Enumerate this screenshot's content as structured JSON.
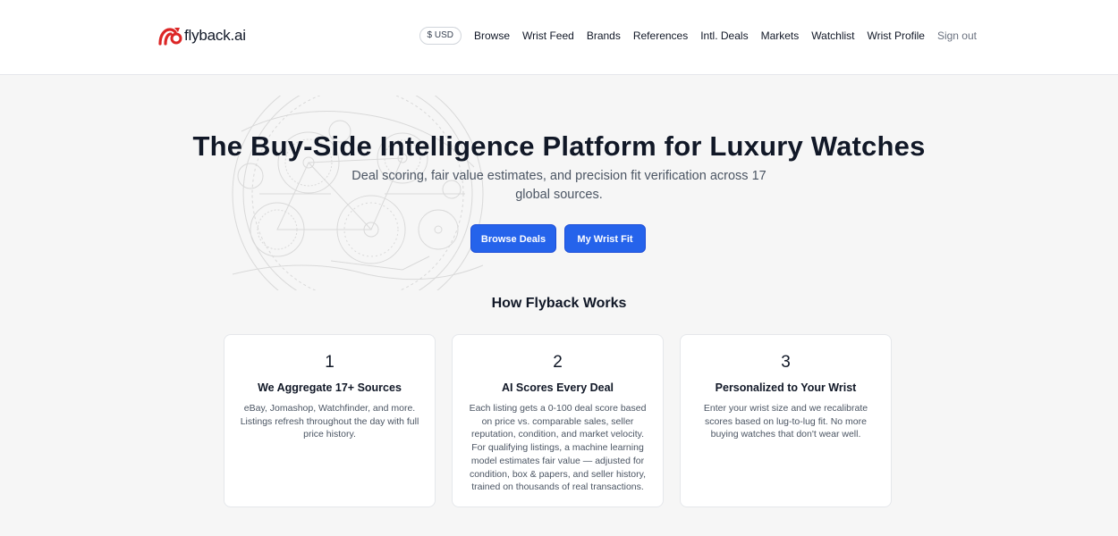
{
  "brand": {
    "name": "flyback.ai",
    "accent": "#dc2626"
  },
  "nav": {
    "currency": "$ USD",
    "links": [
      "Browse",
      "Wrist Feed",
      "Brands",
      "References",
      "Intl. Deals",
      "Markets",
      "Watchlist",
      "Wrist Profile"
    ],
    "sign_out": "Sign out"
  },
  "hero": {
    "title": "The Buy-Side Intelligence Platform for Luxury Watches",
    "subtitle": "Deal scoring, fair value estimates, and precision fit verification across 17 global sources.",
    "primary_button": "Browse Deals",
    "secondary_button": "My Wrist Fit",
    "button_color": "#2563eb"
  },
  "how": {
    "title": "How Flyback Works",
    "steps": [
      {
        "num": "1",
        "title": "We Aggregate 17+ Sources",
        "body": "eBay, Jomashop, Watchfinder, and more. Listings refresh throughout the day with full price history."
      },
      {
        "num": "2",
        "title": "AI Scores Every Deal",
        "body": "Each listing gets a 0-100 deal score based on price vs. comparable sales, seller reputation, condition, and market velocity. For qualifying listings, a machine learning model estimates fair value — adjusted for condition, box & papers, and seller history, trained on thousands of real transactions."
      },
      {
        "num": "3",
        "title": "Personalized to Your Wrist",
        "body": "Enter your wrist size and we recalibrate scores based on lug-to-lug fit. No more buying watches that don't wear well."
      }
    ]
  }
}
